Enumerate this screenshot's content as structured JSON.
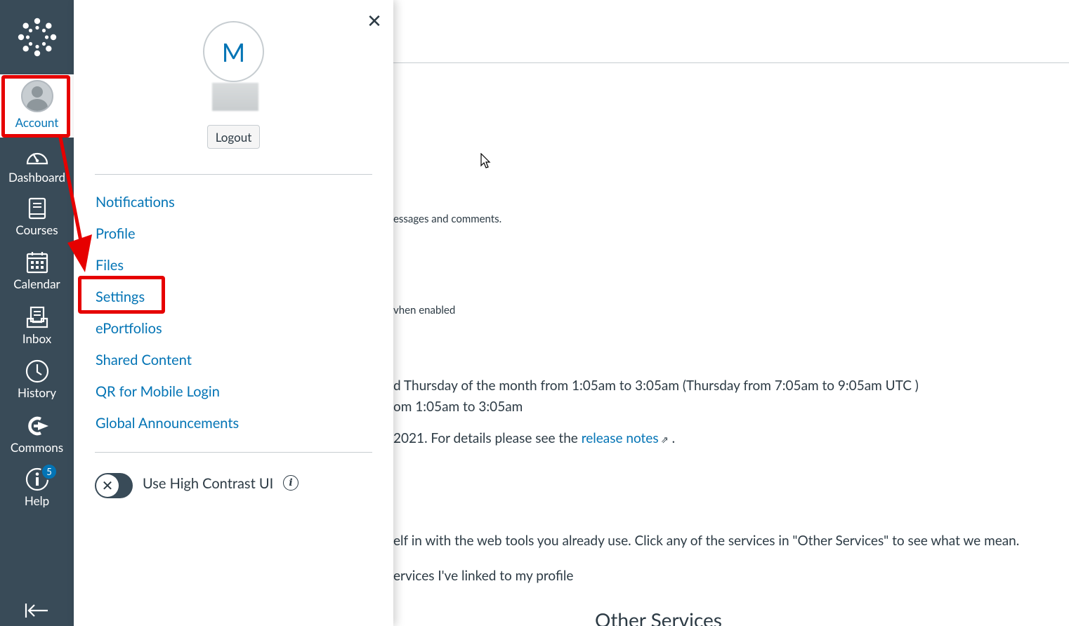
{
  "global_nav": {
    "account": "Account",
    "dashboard": "Dashboard",
    "courses": "Courses",
    "calendar": "Calendar",
    "inbox": "Inbox",
    "history": "History",
    "commons": "Commons",
    "help": "Help",
    "help_badge": "5"
  },
  "tray": {
    "avatar_initial": "M",
    "logout": "Logout",
    "menu": [
      "Notifications",
      "Profile",
      "Files",
      "Settings",
      "ePortfolios",
      "Shared Content",
      "QR for Mobile Login",
      "Global Announcements"
    ],
    "high_contrast_label": "Use High Contrast UI",
    "high_contrast_enabled": false
  },
  "background": {
    "line1": "essages and comments.",
    "line2": "vhen enabled",
    "line3": "d Thursday of the month from 1:05am to 3:05am (Thursday from 7:05am to 9:05am UTC )",
    "line4": "om 1:05am to 3:05am",
    "line5_prefix": "2021. For details please see the ",
    "line5_link": "release notes",
    "line5_suffix": " .",
    "line6": "elf in with the web tools you already use. Click any of the services in \"Other Services\" to see what we mean.",
    "line7": "ervices I've linked to my profile",
    "heading": "Other Services"
  },
  "colors": {
    "nav_bg": "#394b58",
    "link": "#0374b5",
    "annotation": "#e60000"
  }
}
